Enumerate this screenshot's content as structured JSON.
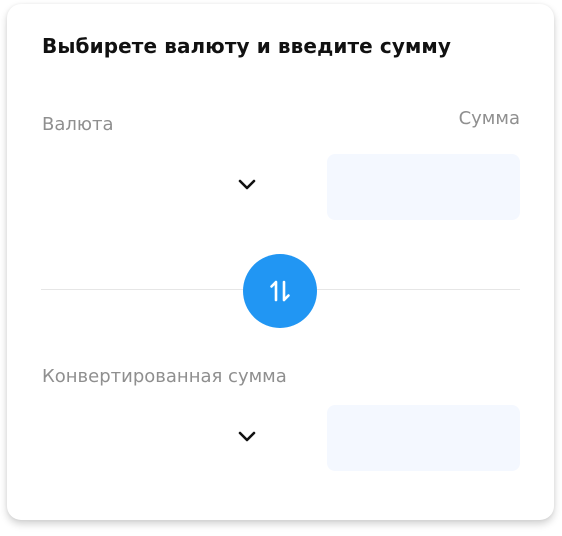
{
  "converter": {
    "title": "Выбирете валюту и введите сумму",
    "currency_label": "Валюта",
    "amount_label": "Сумма",
    "converted_label": "Конвертированная сумма",
    "from_currency": {
      "selected": ""
    },
    "to_currency": {
      "selected": ""
    },
    "amount_input": {
      "value": "",
      "placeholder": ""
    },
    "converted_output": {
      "value": "",
      "placeholder": ""
    }
  },
  "icons": {
    "dropdown": "chevron-down-icon",
    "swap": "swap-arrows-icon"
  },
  "colors": {
    "accent": "#2196f3",
    "input_background": "#f4f8ff",
    "label_text": "#8f8f8f",
    "title_text": "#111111",
    "divider": "#e6e6e6"
  }
}
